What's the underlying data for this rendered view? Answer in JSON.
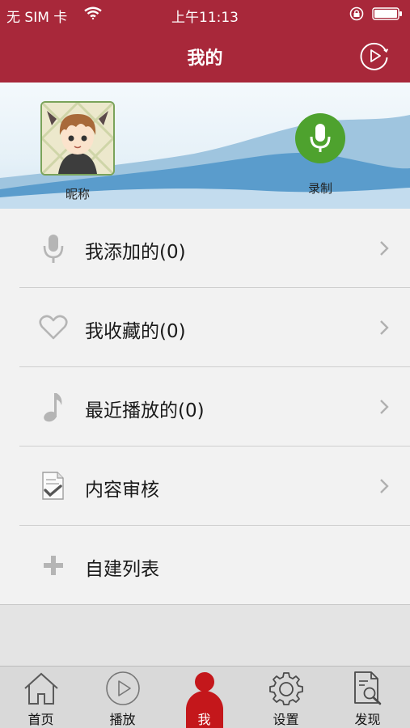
{
  "status_bar": {
    "carrier": "无 SIM 卡",
    "time": "上午11:13",
    "icons": [
      "wifi-icon",
      "rotation-lock-icon",
      "battery-icon"
    ]
  },
  "nav": {
    "title": "我的",
    "right_icon": "play-circle-icon"
  },
  "profile": {
    "nickname": "昵称",
    "record_label": "录制",
    "record_color": "#4ea22e"
  },
  "menu": {
    "items": [
      {
        "label": "我添加的(0)",
        "icon": "microphone-icon",
        "chevron": true
      },
      {
        "label": "我收藏的(0)",
        "icon": "heart-icon",
        "chevron": true
      },
      {
        "label": "最近播放的(0)",
        "icon": "music-note-icon",
        "chevron": true
      },
      {
        "label": "内容审核",
        "icon": "document-check-icon",
        "chevron": true
      },
      {
        "label": "自建列表",
        "icon": "plus-icon",
        "chevron": false
      }
    ]
  },
  "tabs": [
    {
      "label": "首页",
      "icon": "home-icon",
      "active": false
    },
    {
      "label": "播放",
      "icon": "play-icon",
      "active": false
    },
    {
      "label": "我",
      "icon": "person-icon",
      "active": true
    },
    {
      "label": "设置",
      "icon": "gear-icon",
      "active": false
    },
    {
      "label": "发现",
      "icon": "document-search-icon",
      "active": false
    }
  ],
  "colors": {
    "header": "#a8283a",
    "active_tab": "#c4171b",
    "menu_background": "#f2f2f2"
  }
}
